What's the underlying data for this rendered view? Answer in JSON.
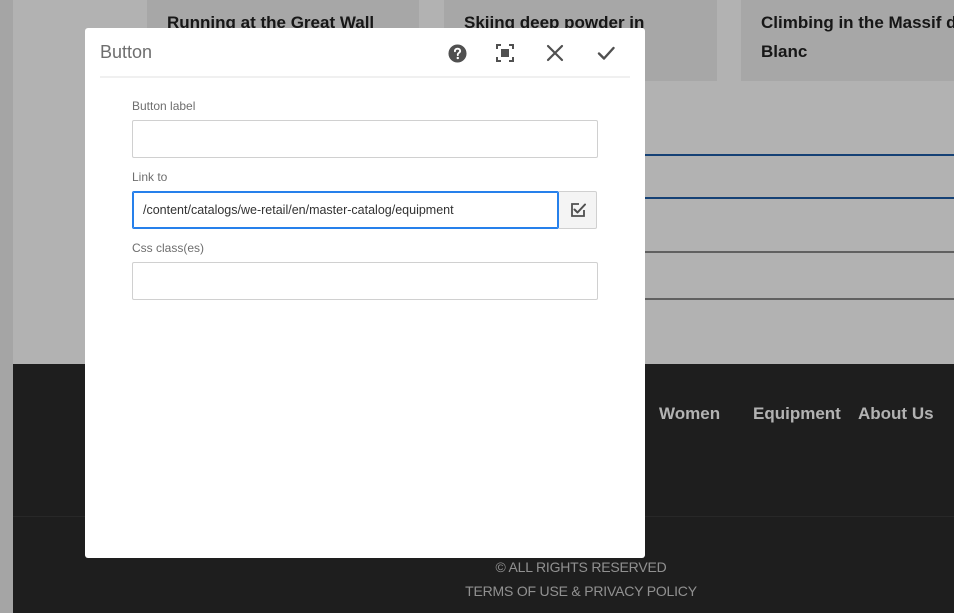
{
  "background_page": {
    "cards": [
      {
        "title": "Running at the Great Wall"
      },
      {
        "title": "Skiing deep powder in"
      },
      {
        "title": "Climbing in the Massif du Mont Blanc"
      }
    ],
    "footer": {
      "nav": [
        "Women",
        "Equipment",
        "About Us"
      ],
      "copyright": "© ALL RIGHTS RESERVED",
      "legal_links": "TERMS OF USE & PRIVACY POLICY"
    }
  },
  "dialog": {
    "title": "Button",
    "header_icons": [
      "help-icon",
      "fullscreen-icon",
      "close-icon",
      "checkmark-icon"
    ],
    "fields": {
      "button_label": {
        "label": "Button label",
        "value": ""
      },
      "link_to": {
        "label": "Link to",
        "value": "/content/catalogs/we-retail/en/master-catalog/equipment"
      },
      "css_classes": {
        "label": "Css class(es)",
        "value": ""
      }
    },
    "picker_icon": "select-checkbox-icon"
  },
  "colors": {
    "accent": "#2680eb",
    "footer_bg": "#2c2c2c",
    "icon": "#505050"
  }
}
